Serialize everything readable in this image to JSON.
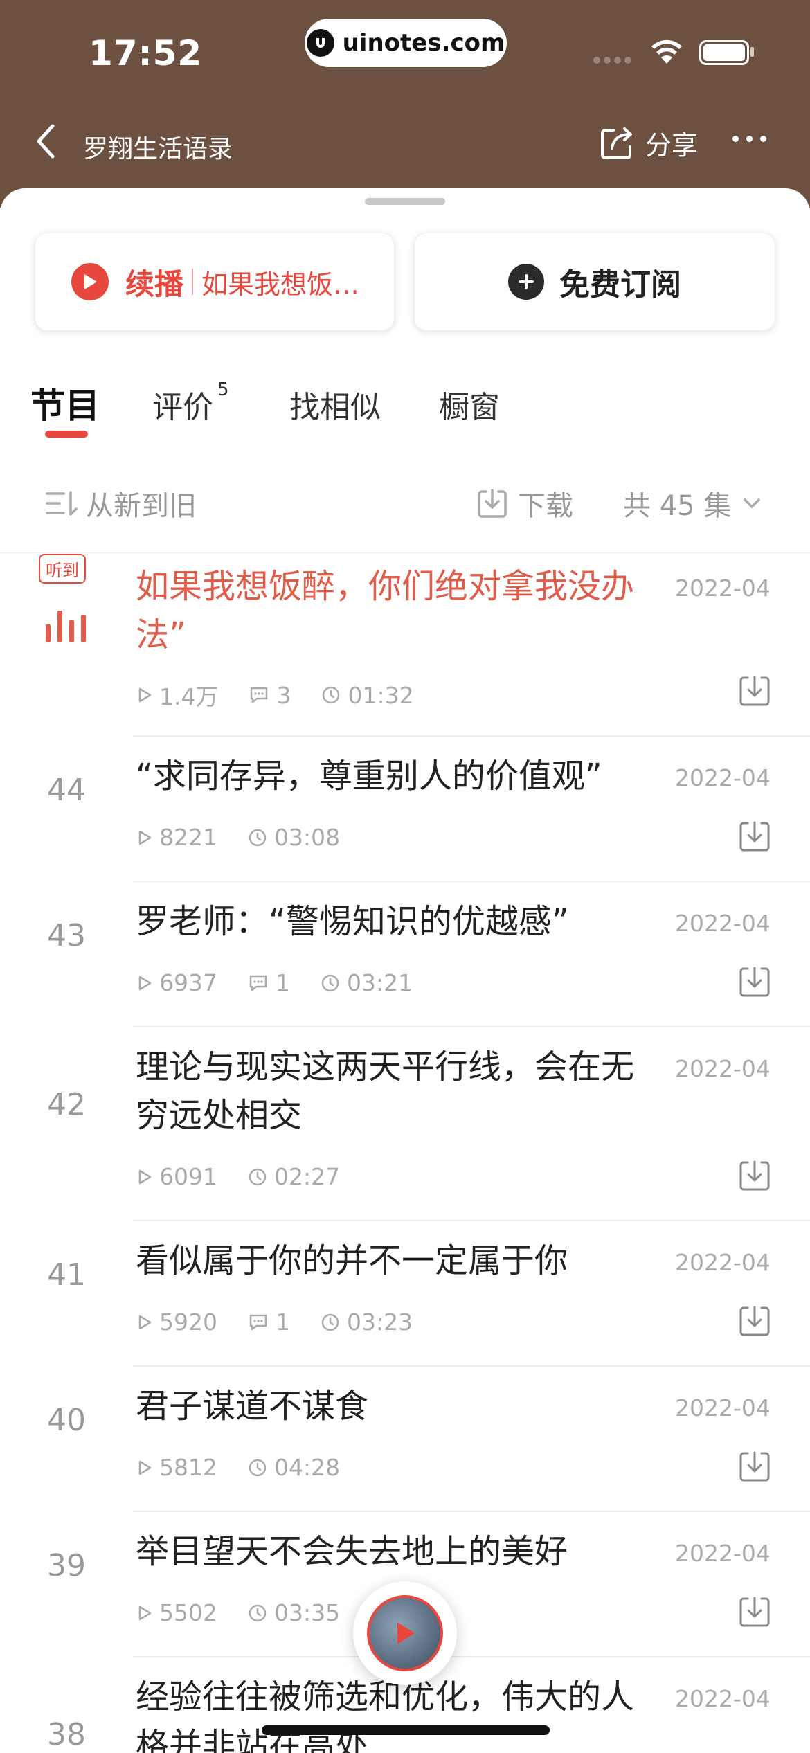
{
  "status_bar": {
    "time": "17:52",
    "url": "uinotes.com"
  },
  "nav": {
    "title": "罗翔生活语录",
    "share_label": "分享"
  },
  "actions": {
    "resume_label": "续播",
    "resume_episode": "如果我想饭…",
    "subscribe_label": "免费订阅"
  },
  "tabs": [
    {
      "label": "节目",
      "badge": ""
    },
    {
      "label": "评价",
      "badge": "5"
    },
    {
      "label": "找相似",
      "badge": ""
    },
    {
      "label": "橱窗",
      "badge": ""
    }
  ],
  "toolbar": {
    "sort_label": "从新到旧",
    "download_label": "下载",
    "count_label": "共 45 集"
  },
  "current": {
    "heard_badge": "听到"
  },
  "episodes": [
    {
      "num": "",
      "title": "如果我想饭醉，你们绝对拿我没办法”",
      "date": "2022-04",
      "plays": "1.4万",
      "comments": "3",
      "duration": "01:32"
    },
    {
      "num": "44",
      "title": "“求同存异，尊重别人的价值观”",
      "date": "2022-04",
      "plays": "8221",
      "comments": "",
      "duration": "03:08"
    },
    {
      "num": "43",
      "title": "罗老师：“警惕知识的优越感”",
      "date": "2022-04",
      "plays": "6937",
      "comments": "1",
      "duration": "03:21"
    },
    {
      "num": "42",
      "title": "理论与现实这两天平行线，会在无穷远处相交",
      "date": "2022-04",
      "plays": "6091",
      "comments": "",
      "duration": "02:27"
    },
    {
      "num": "41",
      "title": "看似属于你的并不一定属于你",
      "date": "2022-04",
      "plays": "5920",
      "comments": "1",
      "duration": "03:23"
    },
    {
      "num": "40",
      "title": "君子谋道不谋食",
      "date": "2022-04",
      "plays": "5812",
      "comments": "",
      "duration": "04:28"
    },
    {
      "num": "39",
      "title": "举目望天不会失去地上的美好",
      "date": "2022-04",
      "plays": "5502",
      "comments": "",
      "duration": "03:35"
    },
    {
      "num": "38",
      "title": "经验往往被筛选和优化，伟大的人格并非站在高处",
      "date": "2022-04",
      "plays": "",
      "comments": "",
      "duration": ""
    }
  ]
}
